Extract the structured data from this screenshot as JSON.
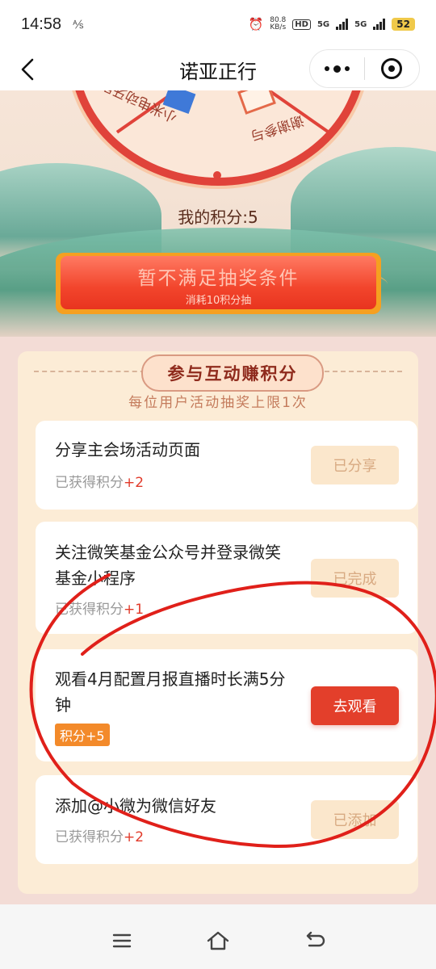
{
  "status_bar": {
    "time": "14:58",
    "vpn": "⅍",
    "net_speed_value": "80.8",
    "net_speed_unit": "KB/s",
    "hd_label": "HD",
    "sim1": "5G",
    "sim2": "5G",
    "battery": "52"
  },
  "header": {
    "title": "诺亚正行"
  },
  "hero": {
    "prize_left": "小米电动牙刷",
    "prize_right": "谢谢参与",
    "points_label": "我的积分:5"
  },
  "draw_button": {
    "label": "暂不满足抽奖条件",
    "sublabel": "消耗10积分抽"
  },
  "tasks_section": {
    "title": "参与互动赚积分",
    "limit_note": "每位用户活动抽奖上限1次",
    "tasks": [
      {
        "name": "分享主会场活动页面",
        "earned_prefix": "已获得积分",
        "earned_value": "+2",
        "button": "已分享"
      },
      {
        "name": "关注微笑基金公众号并登录微笑基金小程序",
        "earned_prefix": "已获得积分",
        "earned_value": "+1",
        "button": "已完成"
      },
      {
        "name": "观看4月配置月报直播时长满5分钟",
        "chip": "积分+5",
        "button": "去观看"
      },
      {
        "name": "添加@小微为微信好友",
        "earned_prefix": "已获得积分",
        "earned_value": "+2",
        "button": "已添加"
      }
    ]
  },
  "colors": {
    "accent_red": "#e33f2b",
    "done_button_bg": "#fbe7cc",
    "panel_bg": "#fcecd6",
    "page_bg": "#f3dcd6",
    "annotation": "#e0201a"
  },
  "icons": {
    "back": "chevron-left-icon",
    "more": "more-dots-icon",
    "close": "target-close-icon",
    "nav_menu": "menu-icon",
    "nav_home": "home-icon",
    "nav_back": "return-icon"
  }
}
